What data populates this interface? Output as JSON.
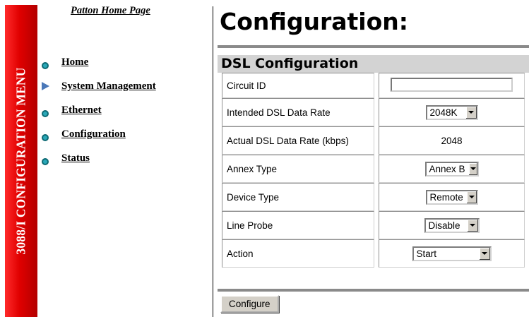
{
  "sidebar": {
    "vertical_title": "3088/I CONFIGURATION MENU",
    "home_link": "Patton Home Page",
    "items": [
      {
        "label": "Home",
        "icon": "bullet-icon"
      },
      {
        "label": "System Management",
        "icon": "triangle-icon"
      },
      {
        "label": "Ethernet",
        "icon": "bullet-icon"
      },
      {
        "label": "Configuration",
        "icon": "bullet-icon"
      },
      {
        "label": "Status",
        "icon": "bullet-icon"
      }
    ]
  },
  "colors": {
    "menu_strip": "#e00000",
    "section_bar": "#d3d3d3",
    "rule": "#8a8a8a"
  },
  "main": {
    "title": "Configuration:",
    "section_title": "DSL Configuration",
    "rows": [
      {
        "label": "Circuit ID",
        "value": ""
      },
      {
        "label": "Intended DSL Data Rate",
        "value": "2048K"
      },
      {
        "label": "Actual DSL Data Rate (kbps)",
        "value": "2048"
      },
      {
        "label": "Annex Type",
        "value": "Annex B"
      },
      {
        "label": "Device Type",
        "value": "Remote"
      },
      {
        "label": "Line Probe",
        "value": "Disable"
      },
      {
        "label": "Action",
        "value": "Start"
      }
    ],
    "configure_label": "Configure"
  }
}
